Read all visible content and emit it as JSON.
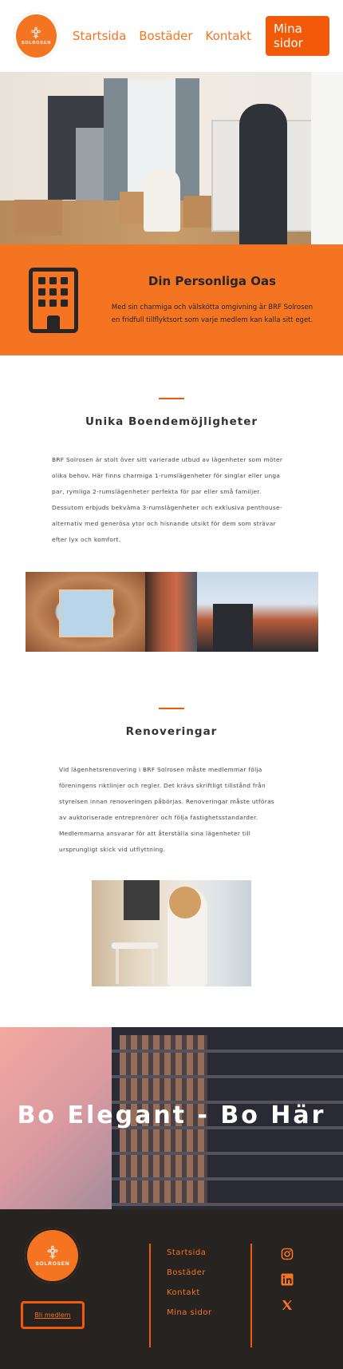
{
  "header": {
    "logo_text": "SOLROSEN",
    "nav": [
      "Startsida",
      "Bostäder",
      "Kontakt"
    ],
    "cta": "Mina sidor"
  },
  "band": {
    "title": "Din Personliga Oas",
    "body": "Med sin charmiga och välskötta omgivning är BRF Solrosen en fridfull tillflyktsort som varje medlem kan kalla sitt eget."
  },
  "section1": {
    "title": "Unika Boendemöjligheter",
    "body": "BRF Solrosen är stolt över sitt varierade utbud av lägenheter som möter olika behov. Här finns charmiga 1-rumslägenheter för singlar eller unga par, rymliga 2-rumslägenheter perfekta för par eller små familjer. Dessutom erbjuds bekväma 3-rumslägenheter och exklusiva penthouse-alternativ med generösa ytor och hisnande utsikt för dem som strävar efter lyx och komfort."
  },
  "section2": {
    "title": "Renoveringar",
    "body": "Vid lägenhetsrenovering i BRF Solrosen måste medlemmar följa föreningens riktlinjer och regler. Det krävs skriftligt tillstånd från styrelsen innan renoveringen påbörjas. Renoveringar måste utföras av auktoriserade entreprenörer och följa fastighetsstandarder. Medlemmarna ansvarar för att återställa sina lägenheter till ursprungligt skick vid utflyttning."
  },
  "banner": {
    "title": "Bo Elegant - Bo Här"
  },
  "footer": {
    "logo_text": "SOLROSEN",
    "join_label": "Bli medlem",
    "links": [
      "Startsida",
      "Bostäder",
      "Kontakt",
      "Mina sidor"
    ],
    "social": [
      "instagram-icon",
      "linkedin-icon",
      "x-icon"
    ]
  },
  "colors": {
    "accent": "#f47421",
    "accent_dark": "#f25a0a",
    "footer_bg": "#262320"
  }
}
